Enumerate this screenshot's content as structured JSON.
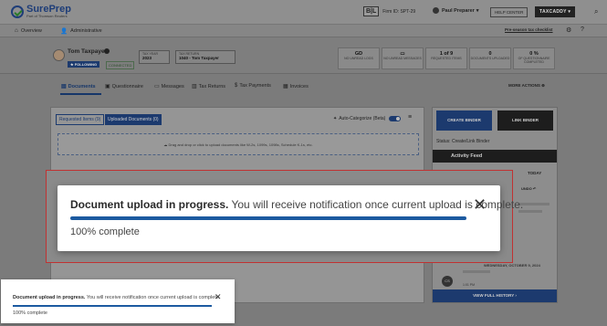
{
  "header": {
    "logo_name": "SurePrep",
    "logo_sub": "Part of Thomson Reuters",
    "firm_badge": "B|L",
    "firm_id": "Firm ID: SPT-29",
    "user_name": "Paul Preparer",
    "help_label": "HELP CENTER",
    "taxcaddy_label": "TAXCADDY"
  },
  "nav": {
    "overview": "Overview",
    "administrative": "Administrative",
    "checklist": "Pre-season tax checklist"
  },
  "client": {
    "name": "Tom Taxpayer",
    "follow_label": "FOLLOWING",
    "connected_label": "CONNECTED",
    "tax_year_label": "TAX YEAR",
    "tax_year_value": "2023",
    "tax_return_label": "TAX RETURN",
    "tax_return_value": "1040 - Tom Taxpayer",
    "stats": [
      {
        "num": "GD",
        "label": "NO UNREAD LOGS"
      },
      {
        "num": "",
        "label": "NO UNREAD MESSAGES"
      },
      {
        "num": "1 of 9",
        "label": "REQUESTED ITEMS"
      },
      {
        "num": "0",
        "label": "DOCUMENTS UPLOADED"
      },
      {
        "num": "0 %",
        "label": "OF QUESTIONNAIRE COMPLETED"
      }
    ]
  },
  "tabs": {
    "documents": "Documents",
    "questionnaire": "Questionnaire",
    "messages": "Messages",
    "tax_returns": "Tax Returns",
    "tax_payments": "Tax Payments",
    "invoices": "Invoices",
    "more_actions": "MORE ACTIONS"
  },
  "documents": {
    "requested_items": "Requested Items (9)",
    "uploaded_documents": "Uploaded Documents (0)",
    "auto_categorize": "Auto-Categorize (Beta)",
    "dropzone_text": "Drag and drop or click to upload documents like W-2s, 1099s, 1098s, Schedule K-1s, etc."
  },
  "binder": {
    "create_label": "CREATE BINDER",
    "link_label": "LINK BINDER",
    "status": "Status: Create/Link Binder",
    "activity_feed": "Activity Feed",
    "today": "TODAY",
    "undo": "UNDO",
    "date_line": "WEDNESDAY, OCTOBER 9, 2024",
    "avatar_initials": "CS",
    "time": "1:01 PM",
    "view_history": "VIEW FULL HISTORY"
  },
  "modal": {
    "title": "Document upload in progress.",
    "message": "You will receive notification once current upload is complete.",
    "percent_label": "100% complete",
    "progress": 1.0,
    "close_icon": "close-icon"
  },
  "toast": {
    "title": "Document upload in progress.",
    "message": "You will receive notification once current upload is complete.",
    "percent_label": "100% complete",
    "progress": 1.0
  },
  "colors": {
    "brand_navy": "#1c3a6e",
    "progress_blue": "#1c5aa0",
    "highlight_red": "#c03232"
  }
}
